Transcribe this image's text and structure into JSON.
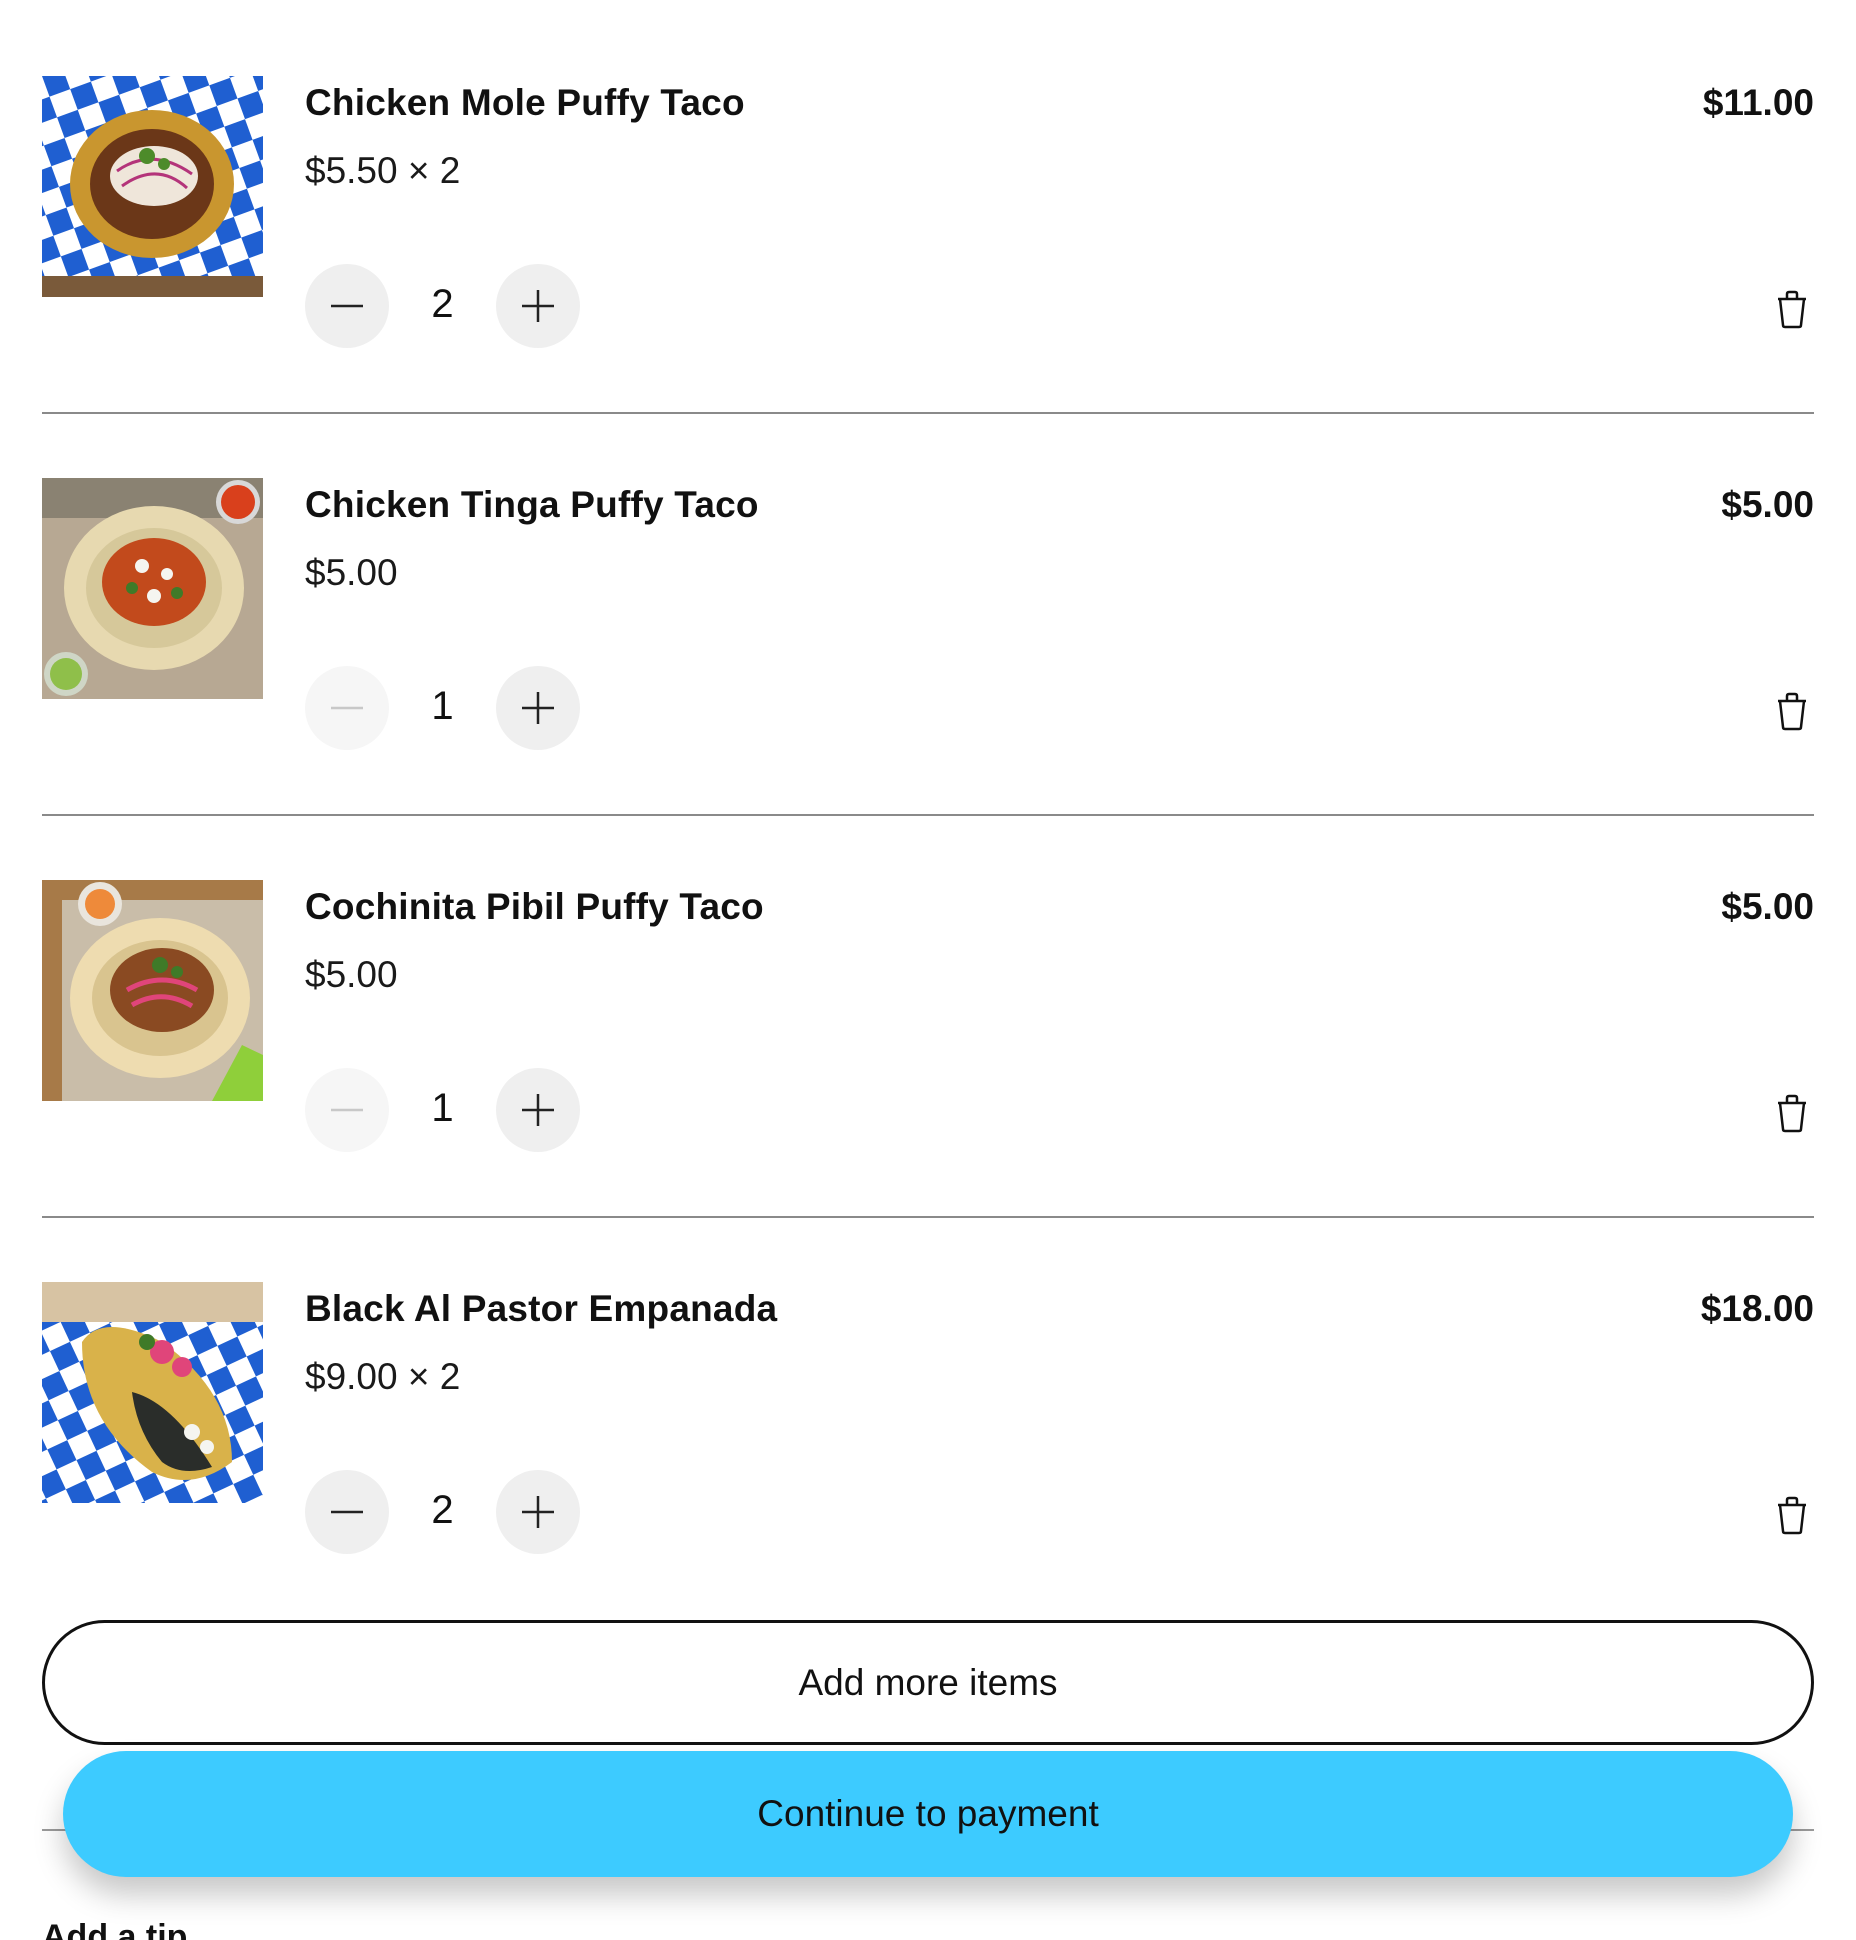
{
  "cart": {
    "items": [
      {
        "name": "Chicken Mole Puffy Taco",
        "unit_price": "$5.50 × 2",
        "line_total": "$11.00",
        "quantity": "2",
        "decrement_enabled": true
      },
      {
        "name": "Chicken Tinga Puffy Taco",
        "unit_price": "$5.00",
        "line_total": "$5.00",
        "quantity": "1",
        "decrement_enabled": false
      },
      {
        "name": "Cochinita Pibil Puffy Taco",
        "unit_price": "$5.00",
        "line_total": "$5.00",
        "quantity": "1",
        "decrement_enabled": false
      },
      {
        "name": "Black Al Pastor Empanada",
        "unit_price": "$9.00 × 2",
        "line_total": "$18.00",
        "quantity": "2",
        "decrement_enabled": true
      }
    ]
  },
  "actions": {
    "add_more_label": "Add more items",
    "continue_label": "Continue to payment"
  },
  "tip": {
    "heading": "Add a tip"
  },
  "icons": {
    "decrement": "minus-icon",
    "increment": "plus-icon",
    "remove": "trash-icon"
  },
  "colors": {
    "primary_button": "#3dcbff",
    "stepper_bg": "#efefef",
    "divider": "#8a8a8a"
  }
}
